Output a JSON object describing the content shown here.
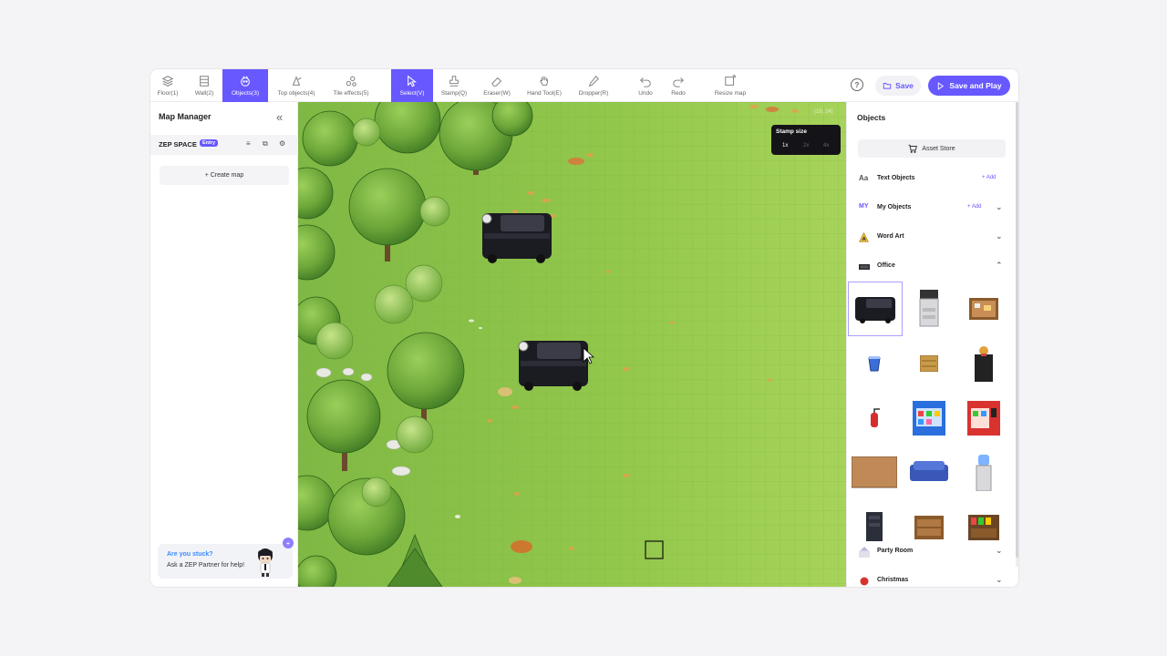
{
  "toolbar": {
    "tools": [
      {
        "label": "Floor(1)",
        "icon": "layers-icon"
      },
      {
        "label": "Wall(2)",
        "icon": "wall-icon"
      },
      {
        "label": "Objects(3)",
        "icon": "objects-icon",
        "active": true
      },
      {
        "label": "Top objects(4)",
        "icon": "top-objects-icon"
      },
      {
        "label": "Tile effects(5)",
        "icon": "tile-effects-icon"
      },
      {
        "label": "Select(V)",
        "icon": "select-cursor-icon",
        "active": true
      },
      {
        "label": "Stamp(Q)",
        "icon": "stamp-icon"
      },
      {
        "label": "Eraser(W)",
        "icon": "eraser-icon"
      },
      {
        "label": "Hand Tool(E)",
        "icon": "hand-icon"
      },
      {
        "label": "Dropper(R)",
        "icon": "dropper-icon"
      },
      {
        "label": "Undo",
        "icon": "undo-icon"
      },
      {
        "label": "Redo",
        "icon": "redo-icon"
      },
      {
        "label": "Resize map",
        "icon": "resize-icon"
      }
    ],
    "help": "?",
    "save_label": "Save",
    "save_play_label": "Save and Play"
  },
  "left": {
    "title": "Map Manager",
    "space_name": "ZEP SPACE",
    "entry_badge": "Entry",
    "create_map": "+ Create map",
    "stuck_title": "Are you stuck?",
    "stuck_sub": "Ask a ZEP Partner for help!"
  },
  "map": {
    "stamp_title": "Stamp size",
    "stamp_options": [
      "1x",
      "2x",
      "4x"
    ],
    "stamp_selected": "1x",
    "coord": "(19, 24)"
  },
  "right": {
    "title": "Objects",
    "asset_store": "Asset Store",
    "categories": [
      {
        "icon": "Aa",
        "label": "Text Objects",
        "add": "+ Add"
      },
      {
        "icon": "MY",
        "label": "My Objects",
        "add": "+ Add",
        "chevron": "down"
      },
      {
        "icon": "word-art-icon",
        "label": "Word Art",
        "chevron": "down"
      },
      {
        "icon": "office-icon",
        "label": "Office",
        "chevron": "up"
      },
      {
        "icon": "party-icon",
        "label": "Party Room",
        "chevron": "down"
      },
      {
        "icon": "christmas-icon",
        "label": "Christmas",
        "chevron": "down"
      }
    ],
    "office_items": [
      "black-van",
      "copier",
      "corkboard",
      "water-bucket",
      "wooden-box",
      "podium-trophy",
      "fire-extinguisher",
      "blue-vending-machine",
      "red-vending-machine",
      "wooden-table",
      "blue-sofa",
      "water-dispenser",
      "dark-cabinet",
      "wooden-shelf",
      "display-shelf"
    ]
  },
  "colors": {
    "accent": "#6758ff",
    "grass": "#8cc24a",
    "tree": "#5f9d33"
  }
}
